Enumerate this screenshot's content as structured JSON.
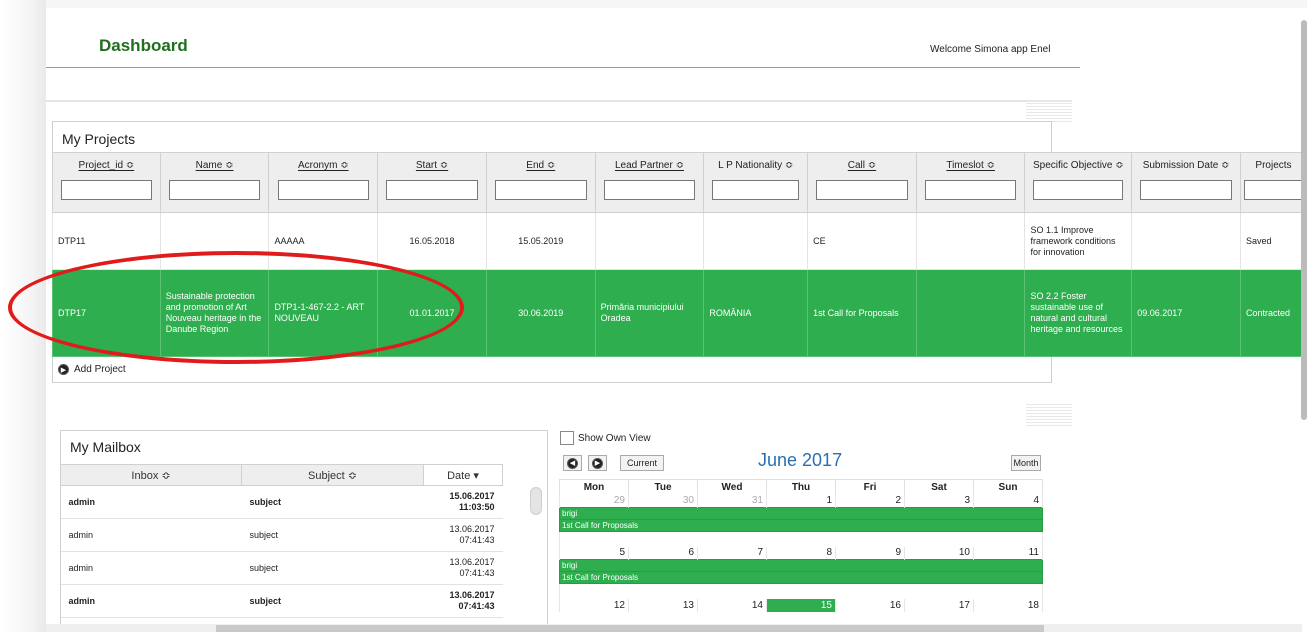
{
  "header": {
    "title": "Dashboard",
    "welcome": "Welcome Simona app Enel"
  },
  "projects": {
    "title": "My Projects",
    "columns": [
      {
        "label": "Project_id ≎",
        "underline": true
      },
      {
        "label": "Name ≎",
        "underline": true
      },
      {
        "label": "Acronym ≎",
        "underline": true
      },
      {
        "label": "Start ≎",
        "underline": true
      },
      {
        "label": "End ≎",
        "underline": true
      },
      {
        "label": "Lead Partner ≎",
        "underline": true
      },
      {
        "label": "L P Nationality ≎",
        "underline": false
      },
      {
        "label": "Call ≎",
        "underline": true
      },
      {
        "label": "Timeslot ≎",
        "underline": true
      },
      {
        "label": "Specific Objective ≎",
        "underline": false
      },
      {
        "label": "Submission Date ≎",
        "underline": false
      },
      {
        "label": "Projects",
        "underline": false
      }
    ],
    "rows": [
      [
        "DTP11",
        "",
        "AAAAA",
        "16.05.2018",
        "15.05.2019",
        "",
        "",
        "CE",
        "",
        "SO 1.1 Improve framework conditions for innovation",
        "",
        "Saved"
      ],
      [
        "DTP17",
        "Sustainable protection and promotion of Art Nouveau heritage in the Danube Region",
        "DTP1-1-467-2.2 - ART NOUVEAU",
        "01.01.2017",
        "30.06.2019",
        "Primăria municipiului Oradea",
        "ROMÂNIA",
        "1st Call for Proposals",
        "",
        "SO 2.2 Foster sustainable use of natural and cultural heritage and resources",
        "09.06.2017",
        "Contracted"
      ]
    ],
    "add_label": "Add Project"
  },
  "mailbox": {
    "title": "My Mailbox",
    "columns": [
      "Inbox ≎",
      "Subject ≎",
      "Date ▾"
    ],
    "rows": [
      {
        "inbox": "admin",
        "subject": "subject",
        "date": "15.06.2017",
        "time": "11:03:50",
        "bold": true
      },
      {
        "inbox": "admin",
        "subject": "subject",
        "date": "13.06.2017",
        "time": "07:41:43",
        "bold": false
      },
      {
        "inbox": "admin",
        "subject": "subject",
        "date": "13.06.2017",
        "time": "07:41:43",
        "bold": false
      },
      {
        "inbox": "admin",
        "subject": "subject",
        "date": "13.06.2017",
        "time": "07:41:43",
        "bold": true
      }
    ]
  },
  "calendar": {
    "show_own_view": "Show Own View",
    "prev_icon": "prev-icon",
    "next_icon": "next-icon",
    "current_label": "Current",
    "month_label": "Month",
    "title": "June 2017",
    "weekdays": [
      "Mon",
      "Tue",
      "Wed",
      "Thu",
      "Fri",
      "Sat",
      "Sun"
    ],
    "weeks": [
      {
        "days": [
          "29",
          "30",
          "31",
          "1",
          "2",
          "3",
          "4"
        ],
        "other": [
          true,
          true,
          true,
          false,
          false,
          false,
          false
        ],
        "events": [
          "brigi",
          "1st Call for Proposals"
        ]
      },
      {
        "days": [
          "5",
          "6",
          "7",
          "8",
          "9",
          "10",
          "11"
        ],
        "other": [
          false,
          false,
          false,
          false,
          false,
          false,
          false
        ],
        "events": [
          "brigi",
          "1st Call for Proposals"
        ]
      },
      {
        "days": [
          "12",
          "13",
          "14",
          "15",
          "16",
          "17",
          "18"
        ],
        "other": [
          false,
          false,
          false,
          false,
          false,
          false,
          false
        ],
        "today": "15",
        "events": []
      }
    ]
  },
  "colors": {
    "brand_green": "#1f6f1f",
    "row_green": "#2fae4f",
    "calendar_title": "#2a6fb0",
    "highlight_red": "#e11b1b"
  }
}
